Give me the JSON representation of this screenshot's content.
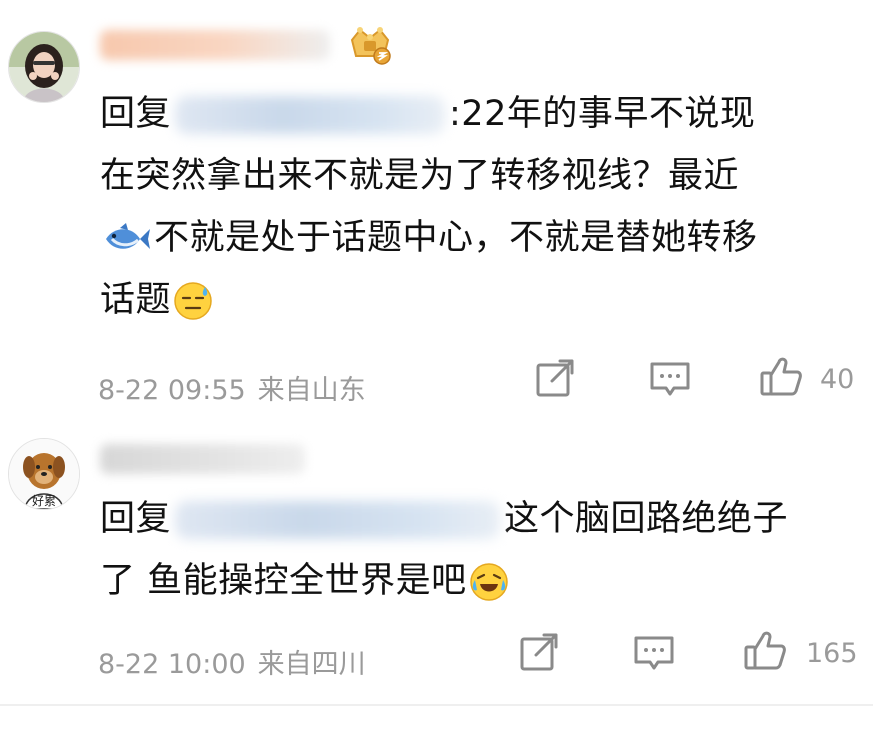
{
  "comments": [
    {
      "reply_prefix": "回复",
      "text_line1_suffix": ":22年的事早不说现",
      "text_line2": "在突然拿出来不就是为了转移视线？最近",
      "text_line3": "不就是处于话题中心，不就是替她转移",
      "text_line4": "话题",
      "date": "8-22 09:55",
      "location": "来自山东",
      "likes": "40",
      "icons": {
        "inline_emoji_1": "fish-icon",
        "inline_emoji_2": "sweat-smile-icon",
        "badge": "vip-badge-icon"
      }
    },
    {
      "reply_prefix": "回复",
      "text_line1_suffix": "这个脑回路绝绝子",
      "text_line2": "了 鱼能操控全世界是吧",
      "avatar_text": "好累",
      "date": "8-22 10:00",
      "location": "来自四川",
      "likes": "165",
      "icons": {
        "inline_emoji_1": "laugh-cry-icon"
      }
    }
  ],
  "colors": {
    "meta_gray": "#9a9a9a",
    "text": "#111111",
    "icon_gray": "#8a8a8a"
  }
}
